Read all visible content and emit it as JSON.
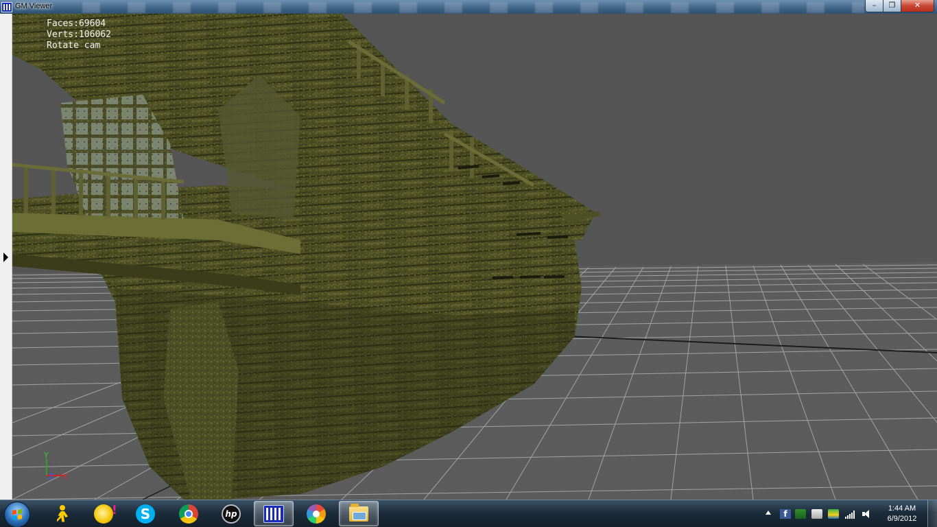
{
  "window": {
    "title": "GM Viewer",
    "buttons": {
      "minimize": "–",
      "maximize": "❐",
      "close": "✕"
    }
  },
  "hud": {
    "faces": "Faces:69604",
    "verts": "Verts:106062",
    "mode": "Rotate cam"
  },
  "viewport": {
    "background_color": "#565656",
    "grid_color": "#bcbcbc",
    "model_color": "#4a4d22",
    "axis_gizmo": {
      "y_label": "Y",
      "z_label": "Z",
      "x_label": "X"
    }
  },
  "taskbar": {
    "pinned": [
      {
        "name": "aim",
        "icon": "aim-icon"
      },
      {
        "name": "yahoo-messenger",
        "icon": "yahoo-messenger-icon"
      },
      {
        "name": "skype",
        "icon": "skype-icon",
        "glyph": "S"
      },
      {
        "name": "chrome",
        "icon": "chrome-icon"
      },
      {
        "name": "hp",
        "icon": "hp-icon",
        "glyph": "hp"
      },
      {
        "name": "gm-viewer",
        "icon": "gm-viewer-icon",
        "active": true
      },
      {
        "name": "picasa",
        "icon": "picasa-icon"
      },
      {
        "name": "windows-explorer",
        "icon": "folder-icon",
        "active": true
      }
    ],
    "tray": {
      "facebook_glyph": "f"
    },
    "clock": {
      "time": "1:44 AM",
      "date": "6/9/2012"
    }
  }
}
